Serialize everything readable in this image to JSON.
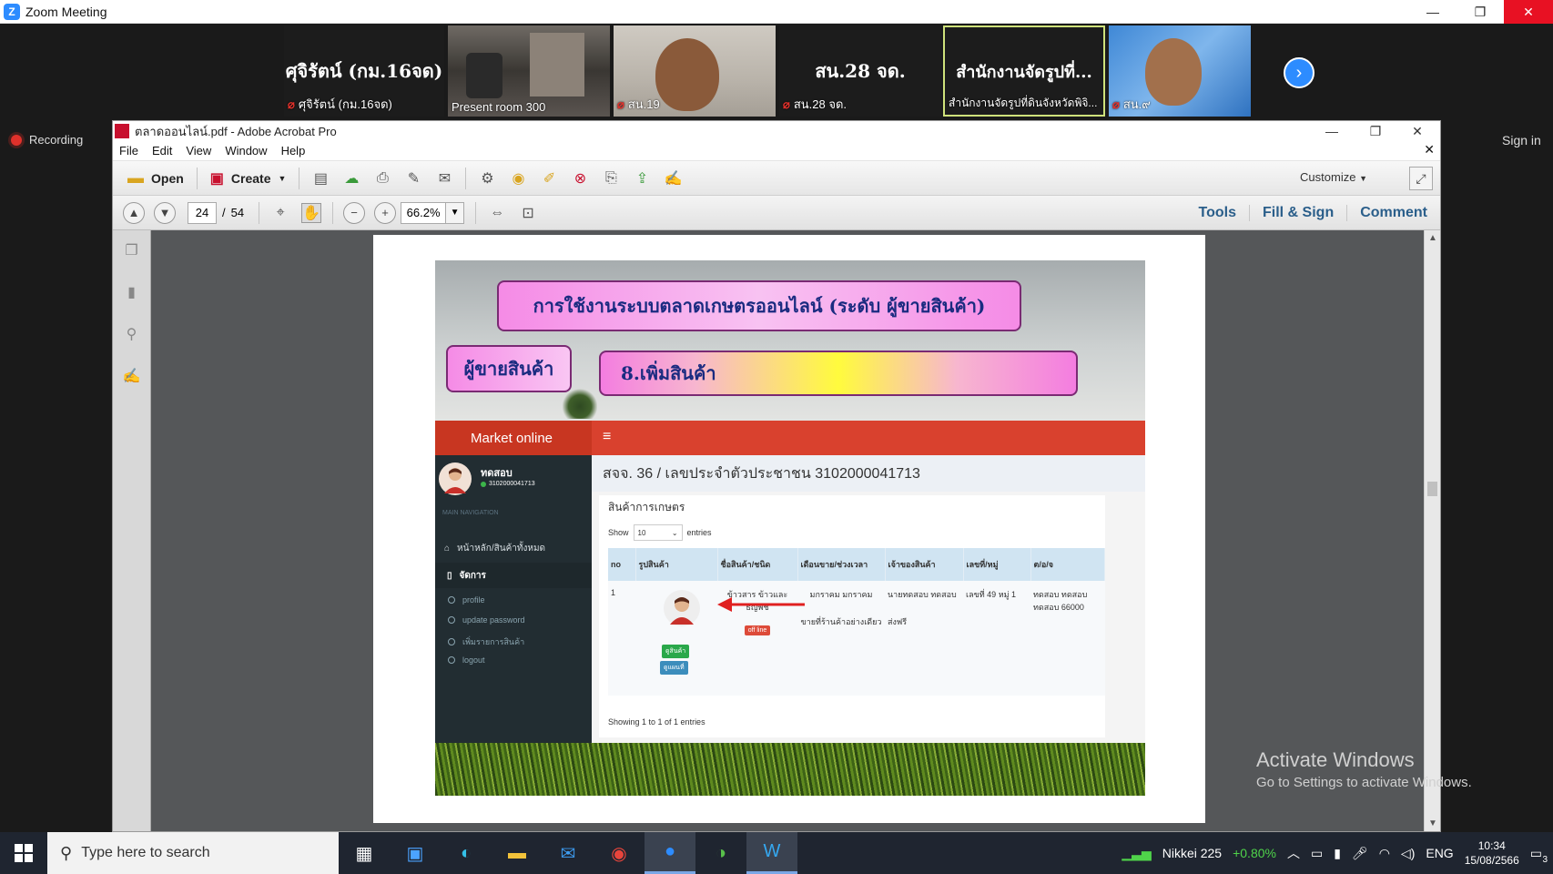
{
  "zoom": {
    "window_title": "Zoom Meeting",
    "window_controls": {
      "minimize": "—",
      "restore": "❐",
      "close": "✕"
    },
    "recording_label": "Recording",
    "sign_in": "Sign in",
    "participants": [
      {
        "big_name": "ศุจิรัตน์ (กม.16จด)",
        "caption": "ศุจิรัตน์ (กม.16จด)",
        "mic_muted": true
      },
      {
        "big_name": "",
        "caption": "Present room 300",
        "mic_muted": false
      },
      {
        "big_name": "",
        "caption": "สน.19",
        "mic_muted": true
      },
      {
        "big_name": "สน.28 จด.",
        "caption": "สน.28 จด.",
        "mic_muted": true
      },
      {
        "big_name": "สำนักงานจัดรูปที่...",
        "caption": "สำนักงานจัดรูปที่ดินจังหวัดพิจิ...",
        "mic_muted": false
      },
      {
        "big_name": "",
        "caption": "สน.๙",
        "mic_muted": true
      }
    ]
  },
  "acrobat": {
    "title": "ตลาดออนไลน์.pdf - Adobe Acrobat Pro",
    "menu": [
      "File",
      "Edit",
      "View",
      "Window",
      "Help"
    ],
    "toolbar": {
      "open": "Open",
      "create": "Create",
      "customize": "Customize"
    },
    "nav": {
      "current_page": "24",
      "page_sep": "/",
      "total_pages": "54",
      "zoom": "66.2%"
    },
    "right_links": [
      "Tools",
      "Fill & Sign",
      "Comment"
    ]
  },
  "slide": {
    "title": "การใช้งานระบบตลาดเกษตรออนไลน์ (ระดับ ผู้ขายสินค้า)",
    "role": "ผู้ขายสินค้า",
    "step": "8.เพิ่มสินค้า",
    "app": {
      "brand": "Market online",
      "menu_icon": "≡",
      "user_name": "ทดสอบ",
      "user_id": "3102000041713",
      "nav_header": "MAIN NAVIGATION",
      "nav_items": [
        "หน้าหลัก/สินค้าทั้งหมด",
        "จัดการ"
      ],
      "sub_items": [
        "profile",
        "update password",
        "เพิ่มรายการสินค้า",
        "logout"
      ],
      "heading": "สจจ. 36 / เลขประจำตัวประชาชน 3102000041713",
      "box_title": "สินค้าการเกษตร",
      "show_label": "Show",
      "show_value": "10",
      "entries_label": "entries",
      "columns": [
        "no",
        "รูปสินค้า",
        "ชื่อสินค้า/ชนิด",
        "เดือนขาย/ช่วงเวลา",
        "เจ้าของสินค้า",
        "เลขที่/หมู่",
        "ต/อ/จ"
      ],
      "row": {
        "no": "1",
        "product": "ข้าวสาร ข้าวและธัญพืช",
        "status_tag": "off line",
        "months": "มกราคม มกราคม",
        "sale_type": "ขายที่ร้านค้าอย่างเดียว",
        "owner": "นายทดสอบ ทดสอบ",
        "delivery": "ส่งฟรี",
        "address": "เลขที่ 49 หมู่ 1",
        "region": "ทดสอบ ทดสอบ ทดสอบ 66000",
        "btn_edit": "ดูสินค้า",
        "btn_view": "ดูแผนที่"
      },
      "showing": "Showing 1 to 1 of 1 entries"
    }
  },
  "watermark": {
    "line1": "Activate Windows",
    "line2": "Go to Settings to activate Windows."
  },
  "taskbar": {
    "search_placeholder": "Type here to search",
    "nikkei_label": "Nikkei 225",
    "nikkei_change": "+0.80%",
    "language": "ENG",
    "time": "10:34",
    "date": "15/08/2566",
    "notif_count": "3"
  },
  "colors": {
    "zoom_blue": "#2d8cff",
    "app_header": "#d9412e",
    "sidebar": "#222d32"
  }
}
